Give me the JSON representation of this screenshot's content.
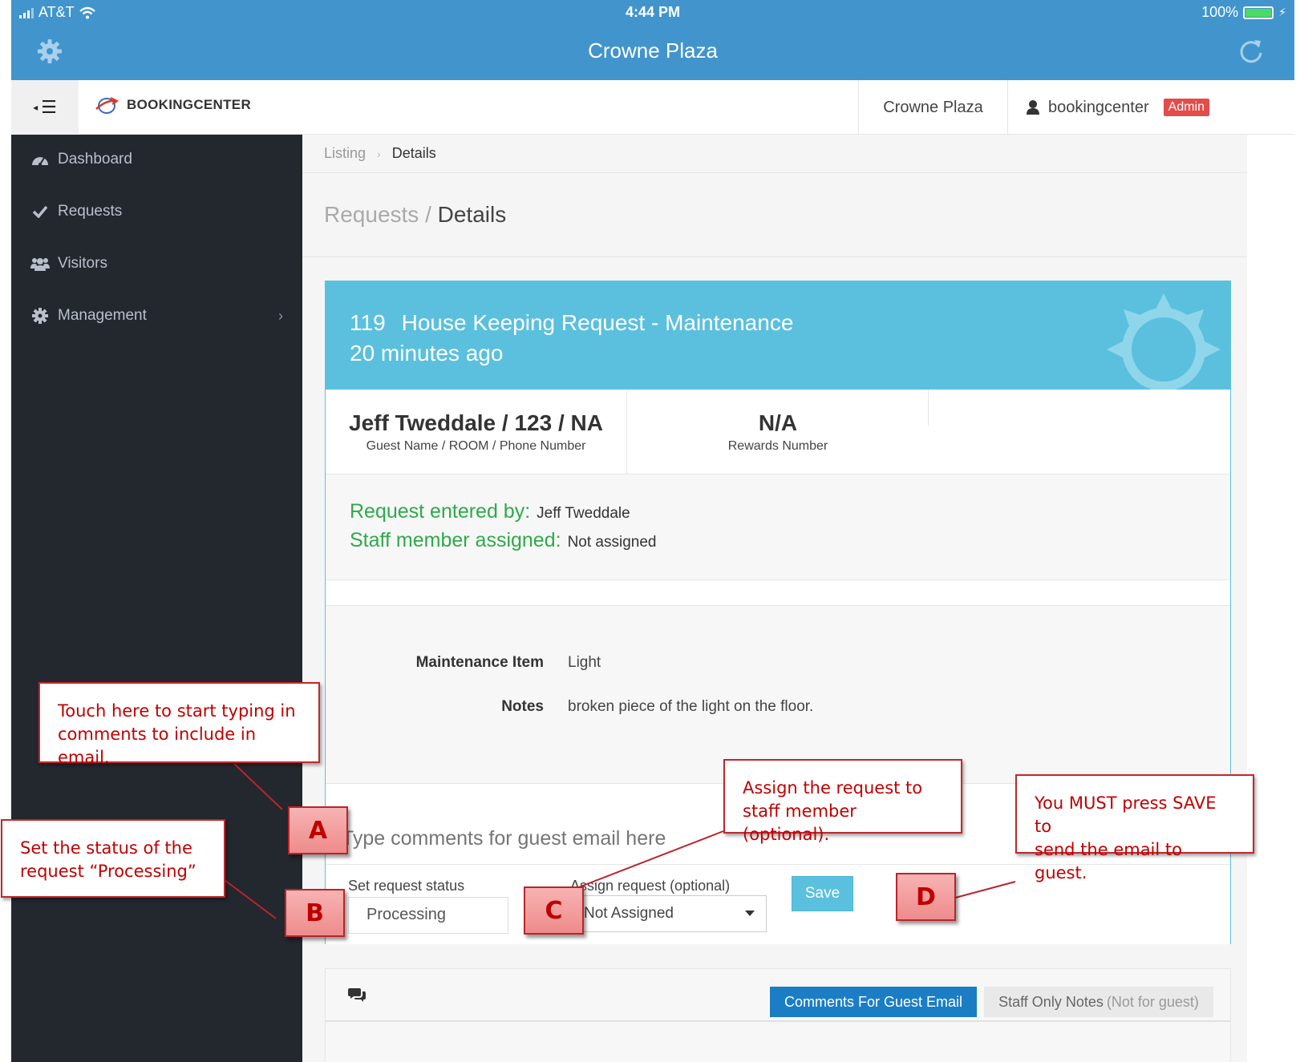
{
  "status_bar": {
    "carrier": "AT&T",
    "time": "4:44 PM",
    "battery": "100%"
  },
  "app_header": {
    "title": "Crowne Plaza",
    "left_icon": "gear-icon",
    "right_icon": "refresh-icon"
  },
  "web_header": {
    "brand": "BOOKINGCENTER",
    "hotel": "Crowne Plaza",
    "username": "bookingcenter",
    "role_badge": "Admin"
  },
  "sidebar": {
    "items": [
      {
        "label": "Dashboard",
        "icon": "dashboard-icon"
      },
      {
        "label": "Requests",
        "icon": "check-icon"
      },
      {
        "label": "Visitors",
        "icon": "users-icon"
      },
      {
        "label": "Management",
        "icon": "gear-icon",
        "has_submenu": true
      }
    ]
  },
  "breadcrumb": {
    "items": [
      "Listing",
      "Details"
    ]
  },
  "page_title": {
    "section": "Requests",
    "separator": "/",
    "current": "Details"
  },
  "request": {
    "id": "119",
    "title": "House Keeping Request - Maintenance",
    "age": "20 minutes ago",
    "guest_value": "Jeff Tweddale / 123 / NA",
    "guest_label": "Guest Name / ROOM / Phone Number",
    "rewards_value": "N/A",
    "rewards_label": "Rewards Number",
    "entered_by_label": "Request entered by:",
    "entered_by": "Jeff Tweddale",
    "assigned_label": "Staff member assigned:",
    "assigned": "Not assigned",
    "details": [
      {
        "key": "Maintenance Item",
        "value": "Light"
      },
      {
        "key": "Notes",
        "value": "broken piece of the light on the floor."
      }
    ]
  },
  "form": {
    "comment_placeholder": "Type comments for guest email here",
    "status_label": "Set request status",
    "status_value": "Processing",
    "assign_label": "Assign request (optional)",
    "assign_value": "Not Assigned",
    "save_label": "Save"
  },
  "tabs": {
    "active": "Comments For Guest Email",
    "inactive": "Staff Only Notes",
    "inactive_note": "(Not for guest)"
  },
  "annotations": {
    "A": {
      "marker": "A",
      "text_line1": "Touch here to start typing in",
      "text_line2": "comments to include in email."
    },
    "B": {
      "marker": "B",
      "text_line1": "Set the status of the",
      "text_line2": "request “Processing”"
    },
    "C": {
      "marker": "C",
      "text_line1": "Assign the request to",
      "text_line2": "staff member (optional)."
    },
    "D": {
      "marker": "D",
      "text_line1": "You MUST press SAVE to",
      "text_line2": "send the email to guest."
    }
  },
  "colors": {
    "app_bar": "#4195cc",
    "card_header": "#5bc0de",
    "sidebar": "#23272e",
    "admin_badge": "#e24c4b",
    "success_text": "#2eaa4a",
    "tab_active": "#1b7dc4",
    "callout_text": "#c00000"
  }
}
